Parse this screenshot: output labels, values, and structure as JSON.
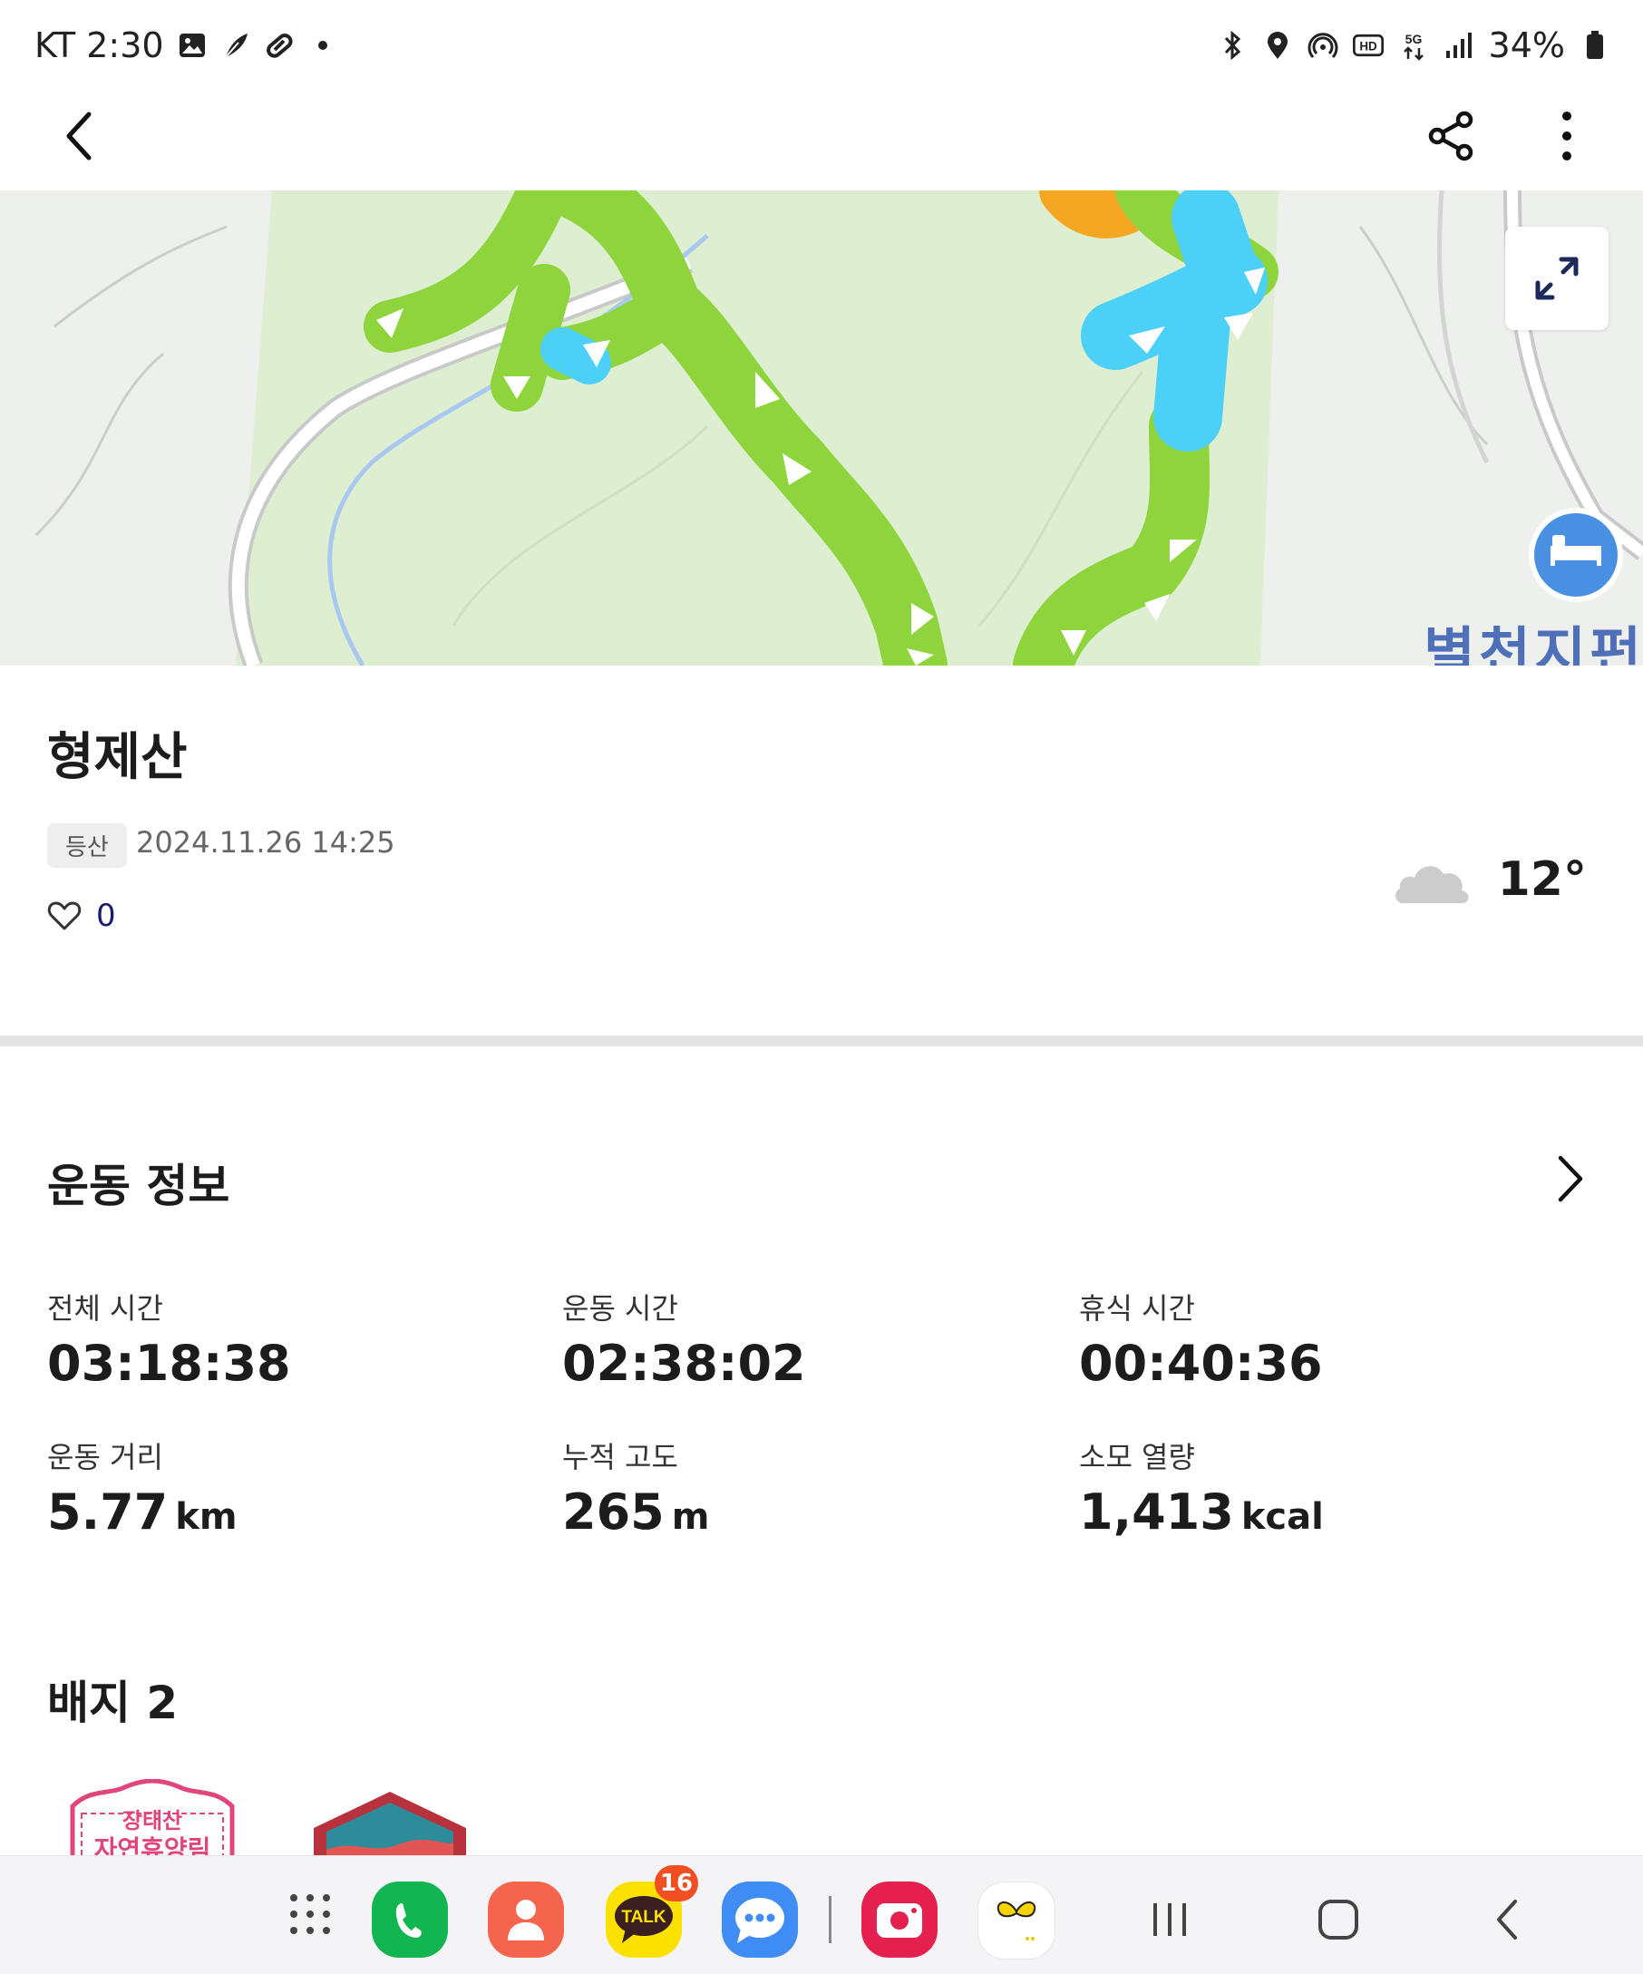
{
  "status_bar": {
    "carrier_time": "KT 2:30",
    "battery": "34%",
    "left_icons": [
      "gallery-icon",
      "feather-icon",
      "pill-icon",
      "dot-icon"
    ],
    "right_icons": [
      "bluetooth-icon",
      "location-icon",
      "hotspot-icon",
      "hd-icon",
      "5g-icon",
      "signal-icon",
      "battery-icon"
    ]
  },
  "top_bar": {
    "back_icon": "back-arrow-icon",
    "share_icon": "share-icon",
    "more_icon": "more-vertical-icon"
  },
  "map": {
    "place_label": "별천지펀",
    "expand_icon": "expand-icon",
    "poi_icon": "bed-icon",
    "colors": {
      "route_green": "#8ed43c",
      "route_blue": "#4dd0f7",
      "route_orange": "#f5a623",
      "park": "#deeed0",
      "poi": "#4a90e2"
    }
  },
  "activity": {
    "title": "형제산",
    "tag": "등산",
    "datetime": "2024.11.26 14:25",
    "likes": "0",
    "weather_icon": "cloud-icon",
    "temperature": "12°"
  },
  "exercise_info": {
    "title": "운동 정보",
    "stats": [
      {
        "label": "전체 시간",
        "value": "03:18:38",
        "unit": ""
      },
      {
        "label": "운동 시간",
        "value": "02:38:02",
        "unit": ""
      },
      {
        "label": "휴식 시간",
        "value": "00:40:36",
        "unit": ""
      },
      {
        "label": "운동 거리",
        "value": "5.77",
        "unit": "km"
      },
      {
        "label": "누적 고도",
        "value": "265",
        "unit": "m"
      },
      {
        "label": "소모 열량",
        "value": "1,413",
        "unit": "kcal"
      }
    ]
  },
  "badges": {
    "title": "배지 2",
    "items": [
      {
        "text_line1": "장태산",
        "text_line2": "자연휴양림"
      },
      {
        "text_line1": "",
        "text_line2": ""
      }
    ]
  },
  "nav_bar": {
    "kakao_badge": "16",
    "kakao_label": "TALK",
    "apps": [
      "app-drawer-icon",
      "phone-app-icon",
      "contacts-app-icon",
      "kakaotalk-app-icon",
      "messages-app-icon",
      "camera-app-icon",
      "butterfly-app-icon"
    ],
    "nav_buttons": [
      "recent-apps-icon",
      "home-icon",
      "back-icon"
    ]
  }
}
